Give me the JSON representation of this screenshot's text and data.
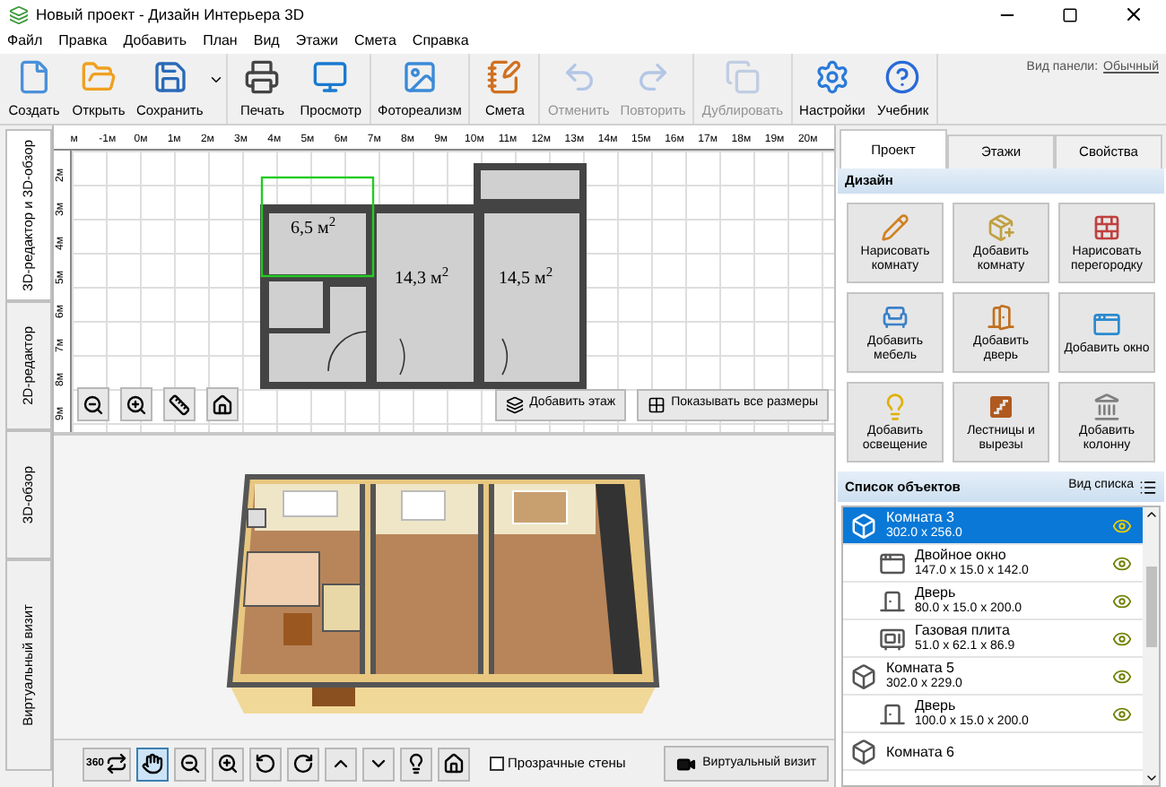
{
  "window": {
    "title": "Новый проект - Дизайн Интерьера 3D"
  },
  "menu": [
    "Файл",
    "Правка",
    "Добавить",
    "План",
    "Вид",
    "Этажи",
    "Смета",
    "Справка"
  ],
  "toolbar": {
    "groups": [
      [
        {
          "kind": "new",
          "label": "Создать",
          "disabled": false,
          "menu": false
        },
        {
          "kind": "open",
          "label": "Открыть",
          "disabled": false,
          "menu": false
        },
        {
          "kind": "save",
          "label": "Сохранить",
          "disabled": false,
          "menu": true
        }
      ],
      [
        {
          "kind": "print",
          "label": "Печать",
          "disabled": false,
          "menu": false
        },
        {
          "kind": "preview",
          "label": "Просмотр",
          "disabled": false,
          "menu": false
        }
      ],
      [
        {
          "kind": "photo",
          "label": "Фотореализм",
          "disabled": false,
          "menu": false
        }
      ],
      [
        {
          "kind": "estimate",
          "label": "Смета",
          "disabled": false,
          "menu": false
        }
      ],
      [
        {
          "kind": "undo",
          "label": "Отменить",
          "disabled": true,
          "menu": false
        },
        {
          "kind": "redo",
          "label": "Повторить",
          "disabled": true,
          "menu": false
        }
      ],
      [
        {
          "kind": "duplicate",
          "label": "Дублировать",
          "disabled": true,
          "menu": false
        }
      ],
      [
        {
          "kind": "settings",
          "label": "Настройки",
          "disabled": false,
          "menu": false
        },
        {
          "kind": "help",
          "label": "Учебник",
          "disabled": false,
          "menu": false
        }
      ]
    ],
    "panel_view": {
      "label": "Вид панели:",
      "value": "Обычный"
    }
  },
  "side_tabs": [
    {
      "label": "3D-редактор и 3D-обзор",
      "selected": true
    },
    {
      "label": "2D-редактор",
      "selected": false
    },
    {
      "label": "3D-обзор",
      "selected": false
    },
    {
      "label": "Виртуальный визит",
      "selected": false
    }
  ],
  "plan": {
    "ruler_x": [
      "м",
      "-1м",
      "0м",
      "1м",
      "2м",
      "3м",
      "4м",
      "5м",
      "6м",
      "7м",
      "8м",
      "9м",
      "10м",
      "11м",
      "12м",
      "13м",
      "14м",
      "15м",
      "16м",
      "17м",
      "18м",
      "19м",
      "20м"
    ],
    "ruler_y": [
      "2м",
      "3м",
      "4м",
      "5м",
      "6м",
      "7м",
      "8м",
      "9м"
    ],
    "rooms": [
      {
        "area": "6,5 м$^{2}$",
        "selected": true
      },
      {
        "area": "14,3 м$^{2}$",
        "selected": false
      },
      {
        "area": "14,5 м$^{2}$",
        "selected": false
      }
    ],
    "tools": [
      {
        "kind": "zoom_out"
      },
      {
        "kind": "zoom_in"
      },
      {
        "kind": "ruler"
      },
      {
        "kind": "home"
      }
    ],
    "buttons": [
      {
        "kind": "add_floor",
        "label": "Добавить этаж"
      },
      {
        "kind": "dimensions",
        "label": "Показывать все размеры"
      }
    ]
  },
  "view3d": {
    "tools": [
      {
        "kind": "orbit",
        "label": "360",
        "selected": false
      },
      {
        "kind": "pan",
        "selected": true
      },
      {
        "kind": "zoom_out",
        "selected": false
      },
      {
        "kind": "zoom_in",
        "selected": false
      },
      {
        "kind": "rotate_left",
        "selected": false
      },
      {
        "kind": "rotate_right",
        "selected": false
      },
      {
        "kind": "tilt_up",
        "selected": false
      },
      {
        "kind": "tilt_down",
        "selected": false
      },
      {
        "kind": "light",
        "selected": false
      },
      {
        "kind": "home",
        "selected": false
      }
    ],
    "transparent_walls": {
      "label": "Прозрачные стены",
      "checked": false
    },
    "tour_button": "Виртуальный визит"
  },
  "panel": {
    "tabs": [
      {
        "label": "Проект",
        "selected": true
      },
      {
        "label": "Этажи",
        "selected": false
      },
      {
        "label": "Свойства",
        "selected": false
      }
    ],
    "design": {
      "title": "Дизайн",
      "buttons": [
        {
          "kind": "draw_room",
          "label": "Нарисовать комнату"
        },
        {
          "kind": "add_room",
          "label": "Добавить комнату"
        },
        {
          "kind": "partition",
          "label": "Нарисовать перегородку"
        },
        {
          "kind": "furniture",
          "label": "Добавить мебель"
        },
        {
          "kind": "door",
          "label": "Добавить дверь"
        },
        {
          "kind": "window",
          "label": "Добавить окно"
        },
        {
          "kind": "light",
          "label": "Добавить освещение"
        },
        {
          "kind": "stairs",
          "label": "Лестницы и вырезы"
        },
        {
          "kind": "column",
          "label": "Добавить колонну"
        }
      ]
    },
    "objects": {
      "title": "Список объектов",
      "view_label": "Вид списка",
      "items": [
        {
          "kind": "room",
          "name": "Комната 3",
          "size": "302.0 x 256.0",
          "selected": true,
          "visible": true,
          "children": [
            {
              "kind": "window",
              "name": "Двойное окно",
              "size": "147.0 x 15.0 x 142.0",
              "selected": false,
              "visible": true
            },
            {
              "kind": "door",
              "name": "Дверь",
              "size": "80.0 x 15.0 x 200.0",
              "selected": false,
              "visible": true
            },
            {
              "kind": "stove",
              "name": "Газовая плита",
              "size": "51.0 x 62.1 x 86.9",
              "selected": false,
              "visible": true
            }
          ]
        },
        {
          "kind": "room",
          "name": "Комната 5",
          "size": "302.0 x 229.0",
          "selected": false,
          "visible": true,
          "children": [
            {
              "kind": "door",
              "name": "Дверь",
              "size": "100.0 x 15.0 x 200.0",
              "selected": false,
              "visible": true
            }
          ]
        },
        {
          "kind": "room",
          "name": "Комната 6",
          "selected": false,
          "visible": false
        }
      ]
    }
  }
}
